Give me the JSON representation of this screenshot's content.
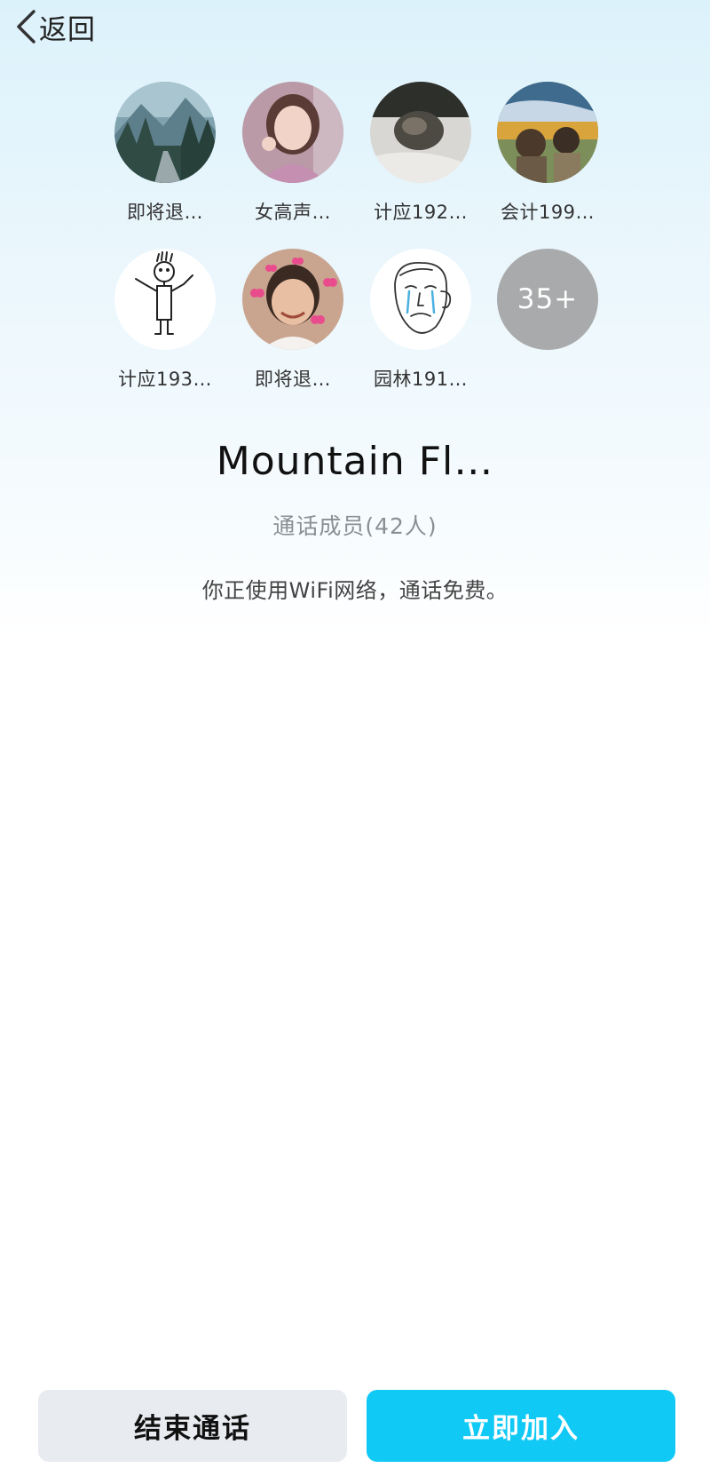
{
  "nav": {
    "back_label": "返回"
  },
  "members": [
    {
      "name": "即将退…",
      "avatar": "mountain-road-photo"
    },
    {
      "name": "女高声…",
      "avatar": "girl-selfie-photo"
    },
    {
      "name": "计应192…",
      "avatar": "cat-photo"
    },
    {
      "name": "会计199…",
      "avatar": "couple-landscape-photo"
    },
    {
      "name": "计应193…",
      "avatar": "stick-figure-drawing"
    },
    {
      "name": "即将退…",
      "avatar": "boy-hearts-photo"
    },
    {
      "name": "园林191…",
      "avatar": "crying-face-sketch"
    }
  ],
  "more_count": "35+",
  "call": {
    "title": "Mountain Fl…",
    "subtitle": "通话成员(42人)",
    "notice": "你正使用WiFi网络，通话免费。"
  },
  "actions": {
    "end_label": "结束通话",
    "join_label": "立即加入"
  },
  "colors": {
    "join_button": "#11c9f5",
    "end_button": "#e8ebf0",
    "more_badge": "#a9aaab"
  }
}
